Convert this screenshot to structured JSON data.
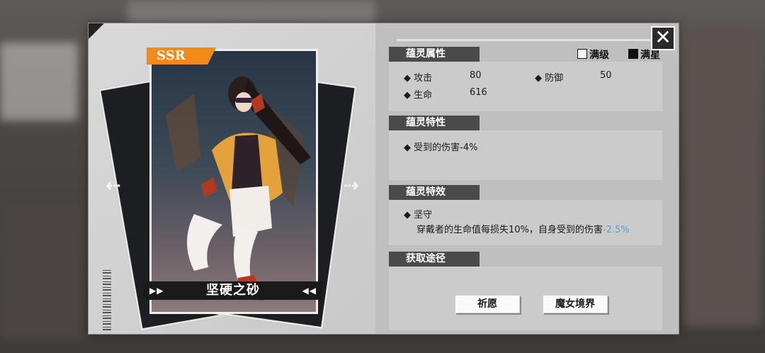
{
  "card": {
    "rarity": "SSR",
    "name": "坚硬之砂",
    "nav_left": "⇠",
    "nav_right": "⇢"
  },
  "toggles": {
    "max_level": {
      "label": "满级",
      "checked": false
    },
    "max_star": {
      "label": "满星",
      "checked": true
    }
  },
  "sections": {
    "attributes": {
      "title": "蕴灵属性",
      "rows": [
        {
          "label": "攻击",
          "value": "80"
        },
        {
          "label": "防御",
          "value": "50"
        },
        {
          "label": "生命",
          "value": "616"
        }
      ]
    },
    "traits": {
      "title": "蕴灵特性",
      "line": "受到的伤害-4%"
    },
    "effects": {
      "title": "蕴灵特效",
      "name": "坚守",
      "desc": "穿戴者的生命值每损失10%，自身受到的伤害",
      "desc_value": "-2.5%"
    },
    "source": {
      "title": "获取途径",
      "buttons": [
        "祈愿",
        "魔女境界"
      ]
    }
  },
  "colors": {
    "accent": "#f28a1a",
    "highlight": "#4aa6d8",
    "header": "#4a4a4a"
  },
  "icons": {
    "close": "close-icon",
    "bullet": "diamond-icon"
  }
}
